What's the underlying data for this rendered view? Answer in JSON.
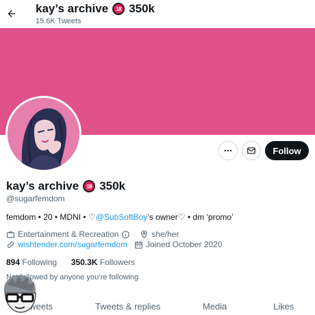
{
  "header": {
    "title": "kay’s archive",
    "title_suffix": "350k",
    "badge": "18",
    "tweet_count": "15.6K Tweets"
  },
  "colors": {
    "banner": "#e0508b",
    "accent": "#1d9bf0",
    "follow_bg": "#0f1419"
  },
  "actions": {
    "more_icon": "more-horizontal-icon",
    "message_icon": "envelope-icon",
    "follow_label": "Follow"
  },
  "profile": {
    "display_name": "kay’s archive",
    "name_suffix": "350k",
    "badge": "18",
    "handle": "@sugarfemdom",
    "bio_prefix": "femdom • 20 • MDNI • ♡",
    "bio_mention": "@SubSoftBoy",
    "bio_suffix": "’s owner♡ • dm ‘promo’",
    "category": "Entertainment & Recreation",
    "location": "she/her",
    "website": "wishtender.com/sugarfemdom",
    "joined": "Joined October 2020"
  },
  "stats": {
    "following_count": "894",
    "following_label": "Following",
    "followers_count": "350.3K",
    "followers_label": "Followers"
  },
  "followed_by": "Not followed by anyone you’re following",
  "tabs": [
    "Tweets",
    "Tweets & replies",
    "Media",
    "Likes"
  ]
}
